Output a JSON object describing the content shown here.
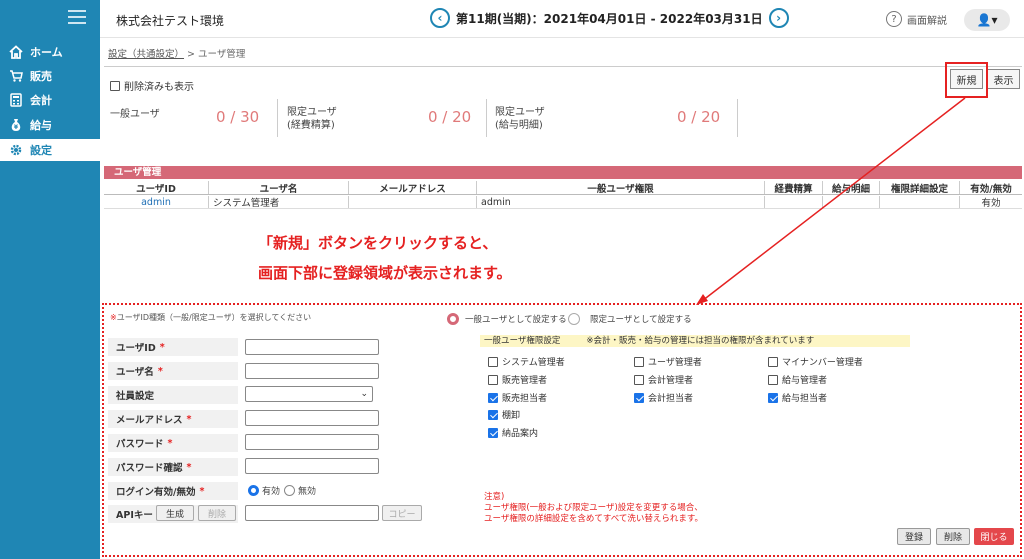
{
  "nav": {
    "items": [
      {
        "label": "ホーム",
        "icon": "home-icon"
      },
      {
        "label": "販売",
        "icon": "cart-icon"
      },
      {
        "label": "会計",
        "icon": "calculator-icon"
      },
      {
        "label": "給与",
        "icon": "money-bag-icon"
      },
      {
        "label": "設定",
        "icon": "gear-icon"
      }
    ]
  },
  "header": {
    "company": "株式会社テスト環境",
    "period": "第11期(当期)：2021年04月01日 - 2022年03月31日",
    "prev": "‹",
    "next": "›",
    "help_label": "画面解説",
    "help_glyph": "?",
    "user_glyph": "👤▾"
  },
  "breadcrumb": {
    "parent": "設定（共通設定）",
    "sep": ">",
    "current": "ユーザ管理"
  },
  "toolbar": {
    "show_deleted": "削除済みも表示",
    "new_label": "新規",
    "show_label": "表示"
  },
  "stats": [
    {
      "label_line1": "一般ユーザ",
      "label_line2": "",
      "value": "0 / 30"
    },
    {
      "label_line1": "限定ユーザ",
      "label_line2": "(経費精算)",
      "value": "0 / 20"
    },
    {
      "label_line1": "限定ユーザ",
      "label_line2": "(給与明細)",
      "value": "0 / 20"
    }
  ],
  "table": {
    "title": "ユーザ管理",
    "headers": [
      "ユーザID",
      "ユーザ名",
      "メールアドレス",
      "一般ユーザ権限",
      "経費精算",
      "給与明細",
      "権限詳細設定",
      "有効/無効"
    ],
    "rows": [
      [
        "admin",
        "システム管理者",
        "",
        "admin",
        "",
        "",
        "",
        "有効"
      ]
    ]
  },
  "annotation": {
    "line1": "「新規」ボタンをクリックすると、",
    "line2": "画面下部に登録領域が表示されます。"
  },
  "form": {
    "note_prefix": "※",
    "note": "ユーザID種類（一般/限定ユーザ）を選択してください",
    "radio_general": "一般ユーザとして設定する",
    "radio_limited": "限定ユーザとして設定する",
    "fields": [
      {
        "label": "ユーザID",
        "required": "*"
      },
      {
        "label": "ユーザ名",
        "required": "*"
      },
      {
        "label": "社員設定",
        "required": ""
      },
      {
        "label": "メールアドレス",
        "required": "*"
      },
      {
        "label": "パスワード",
        "required": "*"
      },
      {
        "label": "パスワード確認",
        "required": "*"
      },
      {
        "label": "ログイン有効/無効",
        "required": "*"
      },
      {
        "label": "APIキー",
        "required": ""
      }
    ],
    "select_arrow": "⌄",
    "login_enabled": "有効",
    "login_disabled": "無効",
    "api_generate": "生成",
    "api_delete": "削除",
    "api_copy": "コピー"
  },
  "permissions": {
    "header_title": "一般ユーザ権限設定",
    "header_note": "※会計・販売・給与の管理には担当の権限が含まれています",
    "items": [
      {
        "label": "システム管理者",
        "checked": false
      },
      {
        "label": "ユーザ管理者",
        "checked": false
      },
      {
        "label": "マイナンバー管理者",
        "checked": false
      },
      {
        "label": "販売管理者",
        "checked": false
      },
      {
        "label": "会計管理者",
        "checked": false
      },
      {
        "label": "給与管理者",
        "checked": false
      },
      {
        "label": "販売担当者",
        "checked": true
      },
      {
        "label": "会計担当者",
        "checked": true
      },
      {
        "label": "給与担当者",
        "checked": true
      },
      {
        "label": "棚卸",
        "checked": true
      },
      {
        "label": "納品案内",
        "checked": true
      }
    ]
  },
  "caution": {
    "title": "注意)",
    "line1": "ユーザ権限(一般および限定ユーザ)設定を変更する場合、",
    "line2": "ユーザ権限の詳細設定を含めてすべて洗い替えられます。"
  },
  "actions": {
    "register": "登録",
    "delete": "削除",
    "close": "閉じる"
  },
  "colors": {
    "accent": "#1f86b4",
    "table_header": "#d56877",
    "annotation": "#e52121"
  }
}
